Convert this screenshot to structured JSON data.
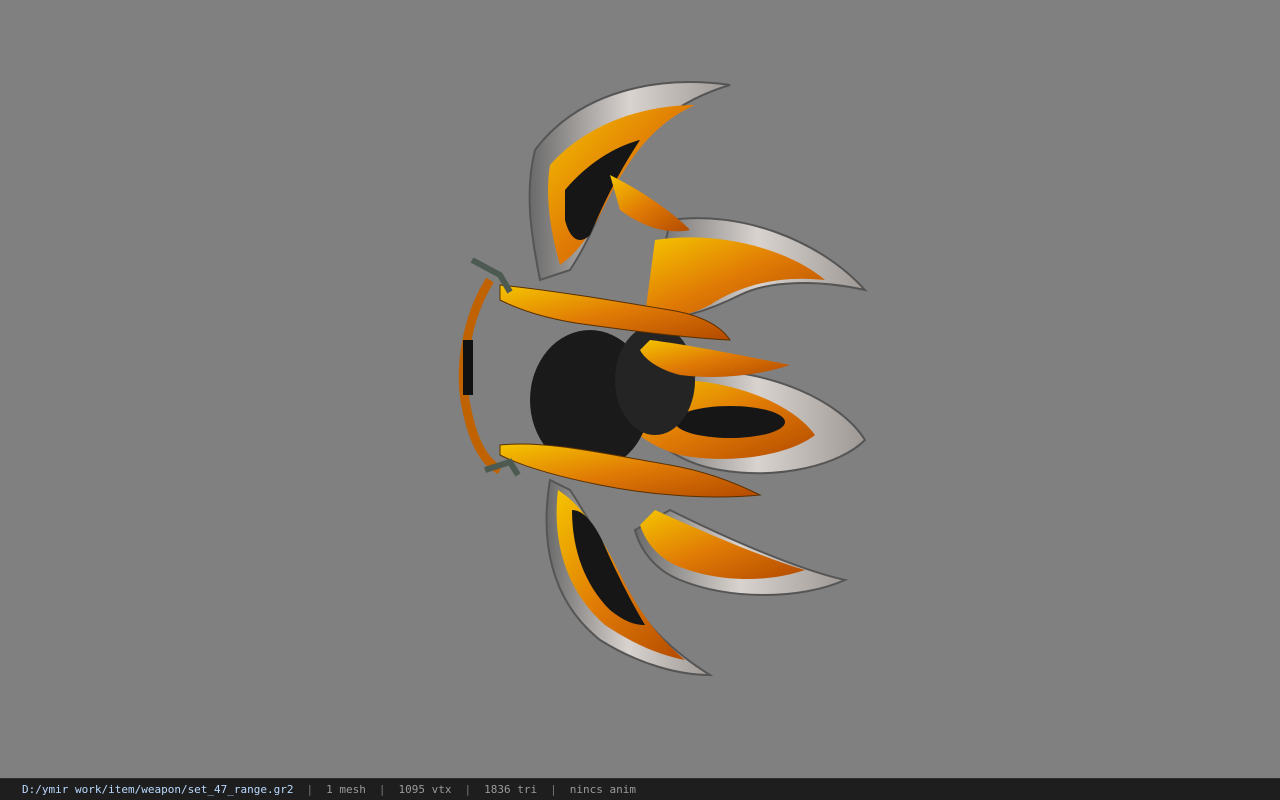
{
  "viewport": {
    "background": "#808080",
    "model_icon": "bow-weapon-model"
  },
  "statusbar": {
    "path": "D:/ymir work/item/weapon/set_47_range.gr2",
    "separator": "|",
    "mesh": "1 mesh",
    "vertices": "1095 vtx",
    "triangles": "1836 tri",
    "anim": "nincs anim"
  }
}
